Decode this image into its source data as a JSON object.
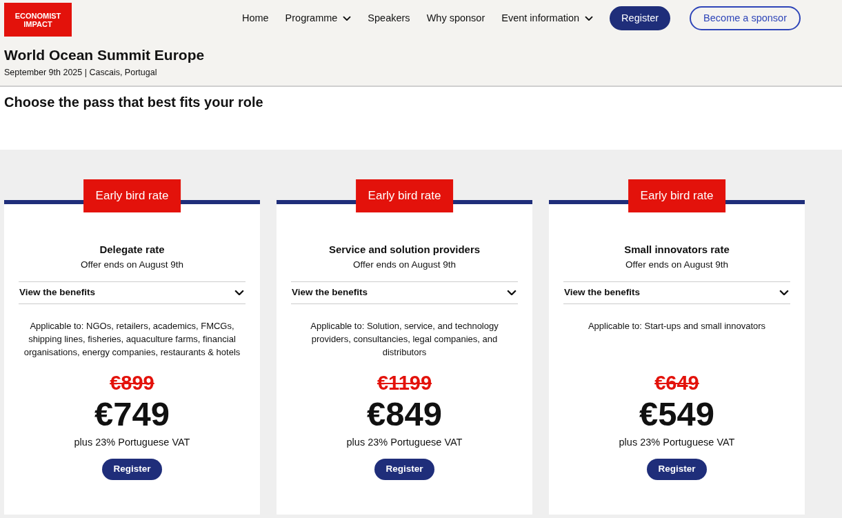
{
  "logo": {
    "lines": [
      "ECONOMIST",
      "IMPACT"
    ]
  },
  "nav": [
    {
      "label": "Home",
      "has_menu": false
    },
    {
      "label": "Programme",
      "has_menu": true
    },
    {
      "label": "Speakers",
      "has_menu": false
    },
    {
      "label": "Why sponsor",
      "has_menu": false
    },
    {
      "label": "Event information",
      "has_menu": true
    }
  ],
  "header_buttons": [
    {
      "label": "Register",
      "kind": "primary"
    },
    {
      "label": "Become a sponsor",
      "kind": "outline"
    }
  ],
  "event": {
    "title": "World Ocean Summit Europe",
    "subtitle": "September 9th 2025 | Cascais, Portugal"
  },
  "heading": "Choose the pass that best fits your role",
  "passes": [
    {
      "badge": "Early bird rate",
      "title": "Delegate rate",
      "offer": "Offer ends on August 9th",
      "benefits": {
        "label": "View the benefits",
        "expanded": false
      },
      "applicable": "Applicable to: NGOs, retailers, academics, FMCGs, shipping lines, fisheries, aquaculture farms, financial organisations, energy companies, restaurants & hotels",
      "old_price": "€899",
      "price": "€749",
      "vat": "plus 23% Portuguese VAT",
      "button": "Register"
    },
    {
      "badge": "Early bird rate",
      "title": "Service and solution providers",
      "offer": "Offer ends on August 9th",
      "benefits": {
        "label": "View the benefits",
        "expanded": false
      },
      "applicable": "Applicable to: Solution, service, and technology providers, consultancies, legal companies, and distributors",
      "old_price": "€1199",
      "price": "€849",
      "vat": "plus 23% Portuguese VAT",
      "button": "Register"
    },
    {
      "badge": "Early bird rate",
      "title": "Small innovators rate",
      "offer": "Offer ends on August 9th",
      "benefits": {
        "label": "View the benefits",
        "expanded": false
      },
      "applicable": "Applicable to: Start-ups and small innovators",
      "old_price": "€649",
      "price": "€549",
      "vat": "plus 23% Portuguese VAT",
      "button": "Register"
    }
  ]
}
